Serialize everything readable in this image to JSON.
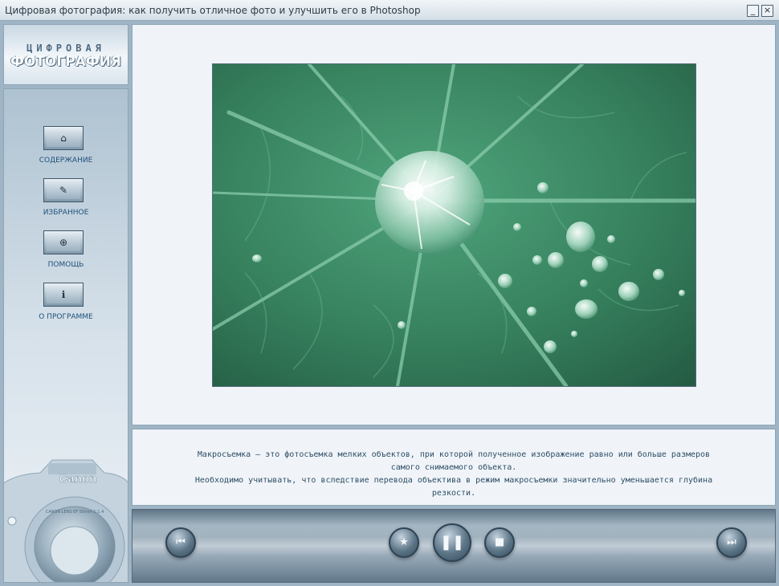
{
  "window": {
    "title": "Цифровая фотография: как получить отличное фото и улучшить его в Photoshop",
    "minimize_glyph": "_",
    "close_glyph": "×"
  },
  "logo": {
    "line1": "ЦИФРОВАЯ",
    "line2": "ФОТОГРАФИЯ"
  },
  "sidebar": {
    "items": [
      {
        "label": "СОДЕРЖАНИЕ",
        "icon": "home-icon",
        "glyph": "⌂"
      },
      {
        "label": "ИЗБРАННОЕ",
        "icon": "wrench-icon",
        "glyph": "✎"
      },
      {
        "label": "ПОМОЩЬ",
        "icon": "lifebuoy-icon",
        "glyph": "⊕"
      },
      {
        "label": "О ПРОГРАММЕ",
        "icon": "info-icon",
        "glyph": "ℹ"
      }
    ],
    "camera_brand": "Canon",
    "lens_text": "CANON LENS EF 50mm 1:1.4"
  },
  "caption": {
    "line1": "Макросъемка — это фотосъемка мелких объектов, при которой полученное  изображение равно или больше размеров",
    "line2": "самого снимаемого объекта.",
    "line3": "Необходимо учитывать, что вследствие перевода объектива в режим макросъемки значительно уменьшается глубина",
    "line4": "резкости."
  },
  "controls": {
    "prev": "⏮",
    "favorite": "★",
    "pause": "❚❚",
    "stop": "■",
    "next": "⏭"
  },
  "colors": {
    "accent": "#21507a",
    "caption_text": "#2d4d66",
    "leaf_green": "#3c8a66"
  }
}
